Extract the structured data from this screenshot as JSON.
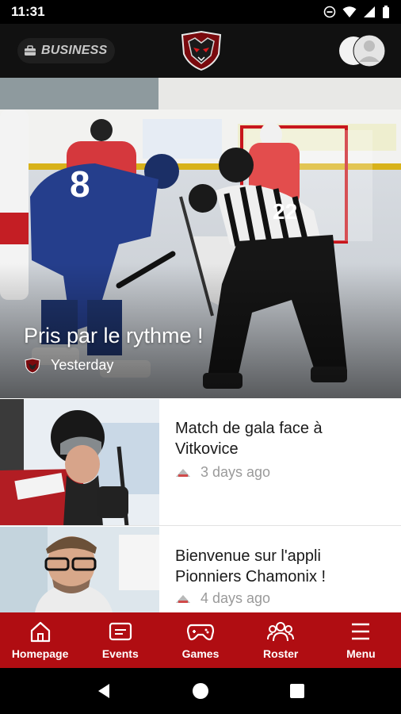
{
  "status_bar": {
    "time": "11:31"
  },
  "header": {
    "business_label": "BUSINESS"
  },
  "hero": {
    "title": "Pris par le rythme !",
    "time_ago": "Yesterday",
    "jersey_number": "8",
    "ref_number": "22"
  },
  "articles": [
    {
      "title": "Match de gala face à Vitkovice",
      "time_ago": "3 days ago"
    },
    {
      "title": "Bienvenue sur l'appli Pionniers Chamonix !",
      "time_ago": "4 days ago"
    }
  ],
  "bottom_nav": [
    {
      "label": "Homepage",
      "icon": "home-icon"
    },
    {
      "label": "Events",
      "icon": "events-icon"
    },
    {
      "label": "Games",
      "icon": "gamepad-icon"
    },
    {
      "label": "Roster",
      "icon": "roster-icon"
    },
    {
      "label": "Menu",
      "icon": "menu-icon"
    }
  ],
  "colors": {
    "brand_red": "#b00d12",
    "header_dark": "#111111"
  }
}
